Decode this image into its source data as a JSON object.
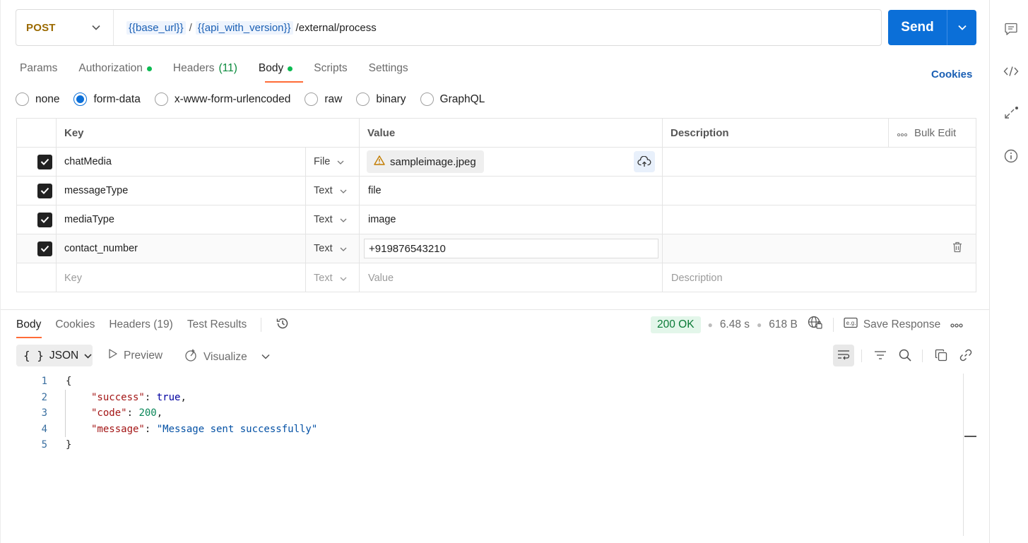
{
  "request": {
    "method": "POST",
    "url": {
      "var1": "{{base_url}}",
      "separator": "/",
      "var2": "{{api_with_version}}",
      "path": "/external/process"
    },
    "send_label": "Send"
  },
  "request_tabs": {
    "params": "Params",
    "authorization": "Authorization",
    "headers": "Headers",
    "headers_count": "(11)",
    "body": "Body",
    "scripts": "Scripts",
    "settings": "Settings",
    "cookies": "Cookies"
  },
  "body_types": {
    "none": "none",
    "form_data": "form-data",
    "urlencoded": "x-www-form-urlencoded",
    "raw": "raw",
    "binary": "binary",
    "graphql": "GraphQL",
    "selected": "form-data"
  },
  "params_table": {
    "headers": {
      "key": "Key",
      "value": "Value",
      "description": "Description",
      "bulk_edit": "Bulk Edit"
    },
    "rows": [
      {
        "checked": true,
        "key": "chatMedia",
        "type": "File",
        "value": "sampleimage.jpeg"
      },
      {
        "checked": true,
        "key": "messageType",
        "type": "Text",
        "value": "file"
      },
      {
        "checked": true,
        "key": "mediaType",
        "type": "Text",
        "value": "image"
      },
      {
        "checked": true,
        "key": "contact_number",
        "type": "Text",
        "value": "+919876543210"
      }
    ],
    "empty_row": {
      "key_placeholder": "Key",
      "type": "Text",
      "value_placeholder": "Value",
      "description_placeholder": "Description"
    }
  },
  "response": {
    "tabs": {
      "body": "Body",
      "cookies": "Cookies",
      "headers": "Headers",
      "headers_count": "(19)",
      "test_results": "Test Results"
    },
    "status": "200 OK",
    "time": "6.48 s",
    "size": "618 B",
    "save_response": "Save Response",
    "format": "JSON",
    "preview": "Preview",
    "visualize": "Visualize",
    "lines": [
      "1",
      "2",
      "3",
      "4",
      "5"
    ],
    "json": {
      "open": "{",
      "close": "}",
      "k1": "\"success\"",
      "v1": "true",
      "k2": "\"code\"",
      "v2": "200",
      "k3": "\"message\"",
      "v3": "\"Message sent successfully\""
    }
  },
  "colors": {
    "accent": "#0b6fd8",
    "tab_underline": "#ff6c37",
    "status_green": "#0cbb52",
    "method_post": "#9b6a00"
  }
}
